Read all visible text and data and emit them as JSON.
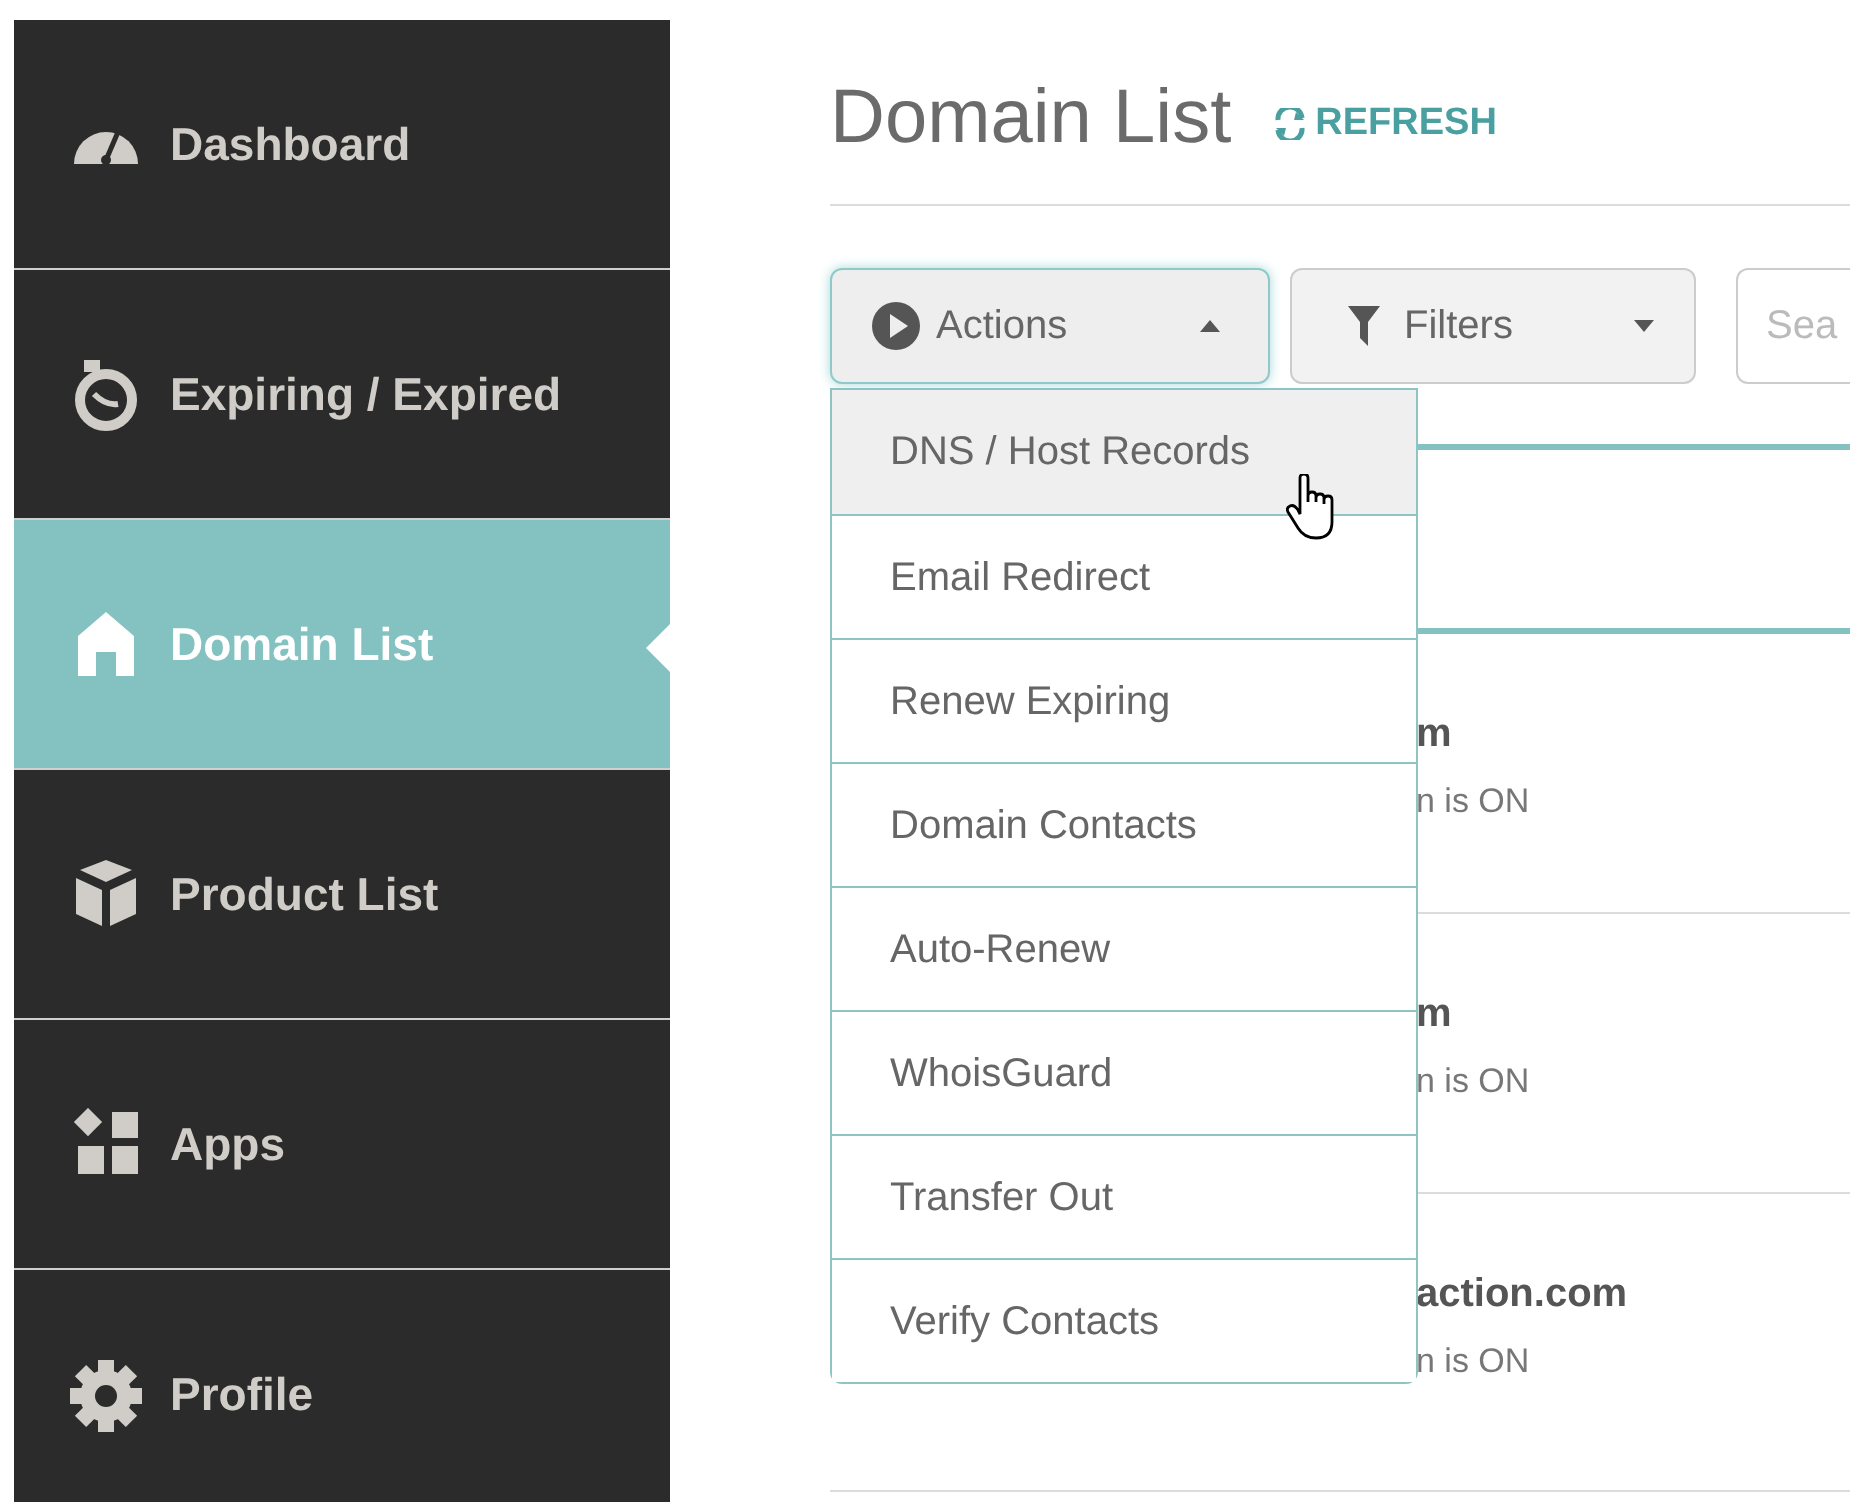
{
  "sidebar": {
    "items": [
      {
        "label": "Dashboard",
        "kind": "gauge",
        "selected": false
      },
      {
        "label": "Expiring / Expired",
        "kind": "timer",
        "selected": false
      },
      {
        "label": "Domain List",
        "kind": "home",
        "selected": true
      },
      {
        "label": "Product List",
        "kind": "box",
        "selected": false
      },
      {
        "label": "Apps",
        "kind": "apps",
        "selected": false
      },
      {
        "label": "Profile",
        "kind": "gear",
        "selected": false
      }
    ]
  },
  "header": {
    "title": "Domain List",
    "refresh": "REFRESH"
  },
  "toolbar": {
    "actions": {
      "label": "Actions",
      "expanded": true
    },
    "filters": {
      "label": "Filters"
    },
    "search": {
      "placeholder": "Sea"
    }
  },
  "actions_menu": [
    {
      "label": "DNS / Host Records",
      "selected": true
    },
    {
      "label": "Email Redirect",
      "selected": false
    },
    {
      "label": "Renew Expiring",
      "selected": false
    },
    {
      "label": "Domain Contacts",
      "selected": false
    },
    {
      "label": "Auto-Renew",
      "selected": false
    },
    {
      "label": "WhoisGuard",
      "selected": false
    },
    {
      "label": "Transfer Out",
      "selected": false
    },
    {
      "label": "Verify Contacts",
      "selected": false
    }
  ],
  "domains": [
    {
      "name": "m",
      "status": "n is ON"
    },
    {
      "name": "m",
      "status": "n is ON"
    },
    {
      "name": "action.com",
      "status": "n is ON"
    }
  ]
}
